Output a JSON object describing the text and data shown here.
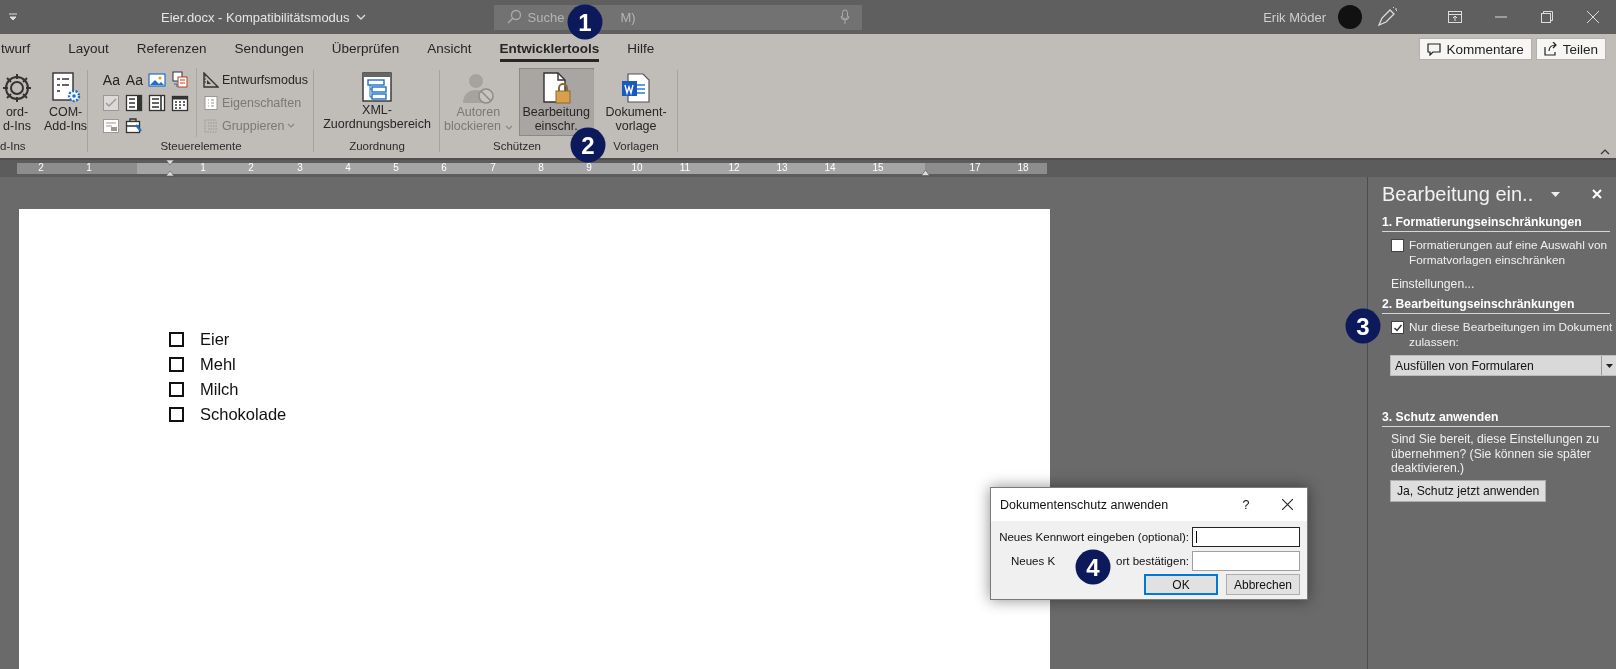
{
  "title_bar": {
    "title": "Eier.docx  -  Kompatibilitätsmodus",
    "search": {
      "text_before": "Suche",
      "text_after": "M)"
    },
    "user": "Erik Möder"
  },
  "tabs": [
    {
      "label": "twurf",
      "selected": false
    },
    {
      "label": "Layout",
      "selected": false
    },
    {
      "label": "Referenzen",
      "selected": false
    },
    {
      "label": "Sendungen",
      "selected": false
    },
    {
      "label": "Überprüfen",
      "selected": false
    },
    {
      "label": "Ansicht",
      "selected": false
    },
    {
      "label": "Entwicklertools",
      "selected": true
    },
    {
      "label": "Hilfe",
      "selected": false
    }
  ],
  "header_buttons": [
    {
      "label": "Kommentare"
    },
    {
      "label": "Teilen"
    }
  ],
  "ribbon_groups": [
    {
      "label": "d-Ins",
      "kind": "buttons",
      "buttons": [
        {
          "lines": [
            "ord-",
            "d-Ins"
          ],
          "disabled": false,
          "selected": false,
          "dropdown": false
        },
        {
          "lines": [
            "COM-",
            "Add-Ins"
          ],
          "disabled": false,
          "selected": false,
          "dropdown": false
        }
      ]
    },
    {
      "label": "Steuerelemente",
      "kind": "controls",
      "text_icons": [
        "Aa",
        "Aa"
      ],
      "commands": [
        {
          "label": "Entwurfsmodus",
          "disabled": false,
          "dropdown": false
        },
        {
          "label": "Eigenschaften",
          "disabled": true,
          "dropdown": false
        },
        {
          "label": "Gruppieren",
          "disabled": true,
          "dropdown": true
        }
      ]
    },
    {
      "label": "Zuordnung",
      "kind": "buttons",
      "buttons": [
        {
          "lines": [
            "XML-",
            "Zuordnungsbereich"
          ],
          "disabled": false,
          "selected": false,
          "dropdown": false
        }
      ]
    },
    {
      "label": "Schützen",
      "kind": "buttons",
      "buttons": [
        {
          "lines": [
            "Autoren",
            "blockieren"
          ],
          "disabled": true,
          "selected": false,
          "dropdown": true
        },
        {
          "lines": [
            "Bearbeitung",
            "einschr."
          ],
          "disabled": false,
          "selected": true,
          "dropdown": false
        }
      ]
    },
    {
      "label": "Vorlagen",
      "kind": "buttons",
      "buttons": [
        {
          "lines": [
            "Dokument-",
            "vorlage"
          ],
          "disabled": false,
          "selected": false,
          "dropdown": false
        }
      ]
    }
  ],
  "ruler": {
    "labels": [
      "2",
      "1",
      "1",
      "2",
      "3",
      "4",
      "5",
      "6",
      "7",
      "8",
      "9",
      "10",
      "11",
      "12",
      "13",
      "14",
      "15",
      "17",
      "18"
    ]
  },
  "document": {
    "checklist": [
      {
        "label": "Eier",
        "checked": false
      },
      {
        "label": "Mehl",
        "checked": false
      },
      {
        "label": "Milch",
        "checked": false
      },
      {
        "label": "Schokolade",
        "checked": false
      }
    ]
  },
  "task_pane": {
    "title": "Bearbeitung ein..",
    "sections": [
      {
        "heading": "1. Formatierungseinschränkungen",
        "checkbox": {
          "label": "Formatierungen auf eine Auswahl von Formatvorlagen einschränken",
          "checked": false
        },
        "link": "Einstellungen..."
      },
      {
        "heading": "2. Bearbeitungseinschränkungen",
        "checkbox": {
          "label": "Nur diese Bearbeitungen im Dokument zulassen:",
          "checked": true
        },
        "dropdown": "Ausfüllen von Formularen"
      },
      {
        "heading": "3. Schutz anwenden",
        "text": "Sind Sie bereit, diese Einstellungen zu übernehmen? (Sie können sie später deaktivieren.)",
        "button": "Ja, Schutz jetzt anwenden"
      }
    ]
  },
  "dialog": {
    "title": "Dokumentenschutz anwenden",
    "help": "?",
    "fields": [
      {
        "label": "Neues Kennwort eingeben (optional):",
        "focused": true
      },
      {
        "label": "Neues K",
        "label_after": "ort bestätigen:",
        "focused": false
      }
    ],
    "buttons": [
      {
        "label": "OK",
        "default": true
      },
      {
        "label": "Abbrechen",
        "default": false
      }
    ]
  },
  "badges": [
    {
      "number": "1"
    },
    {
      "number": "2"
    },
    {
      "number": "3"
    },
    {
      "number": "4"
    }
  ]
}
